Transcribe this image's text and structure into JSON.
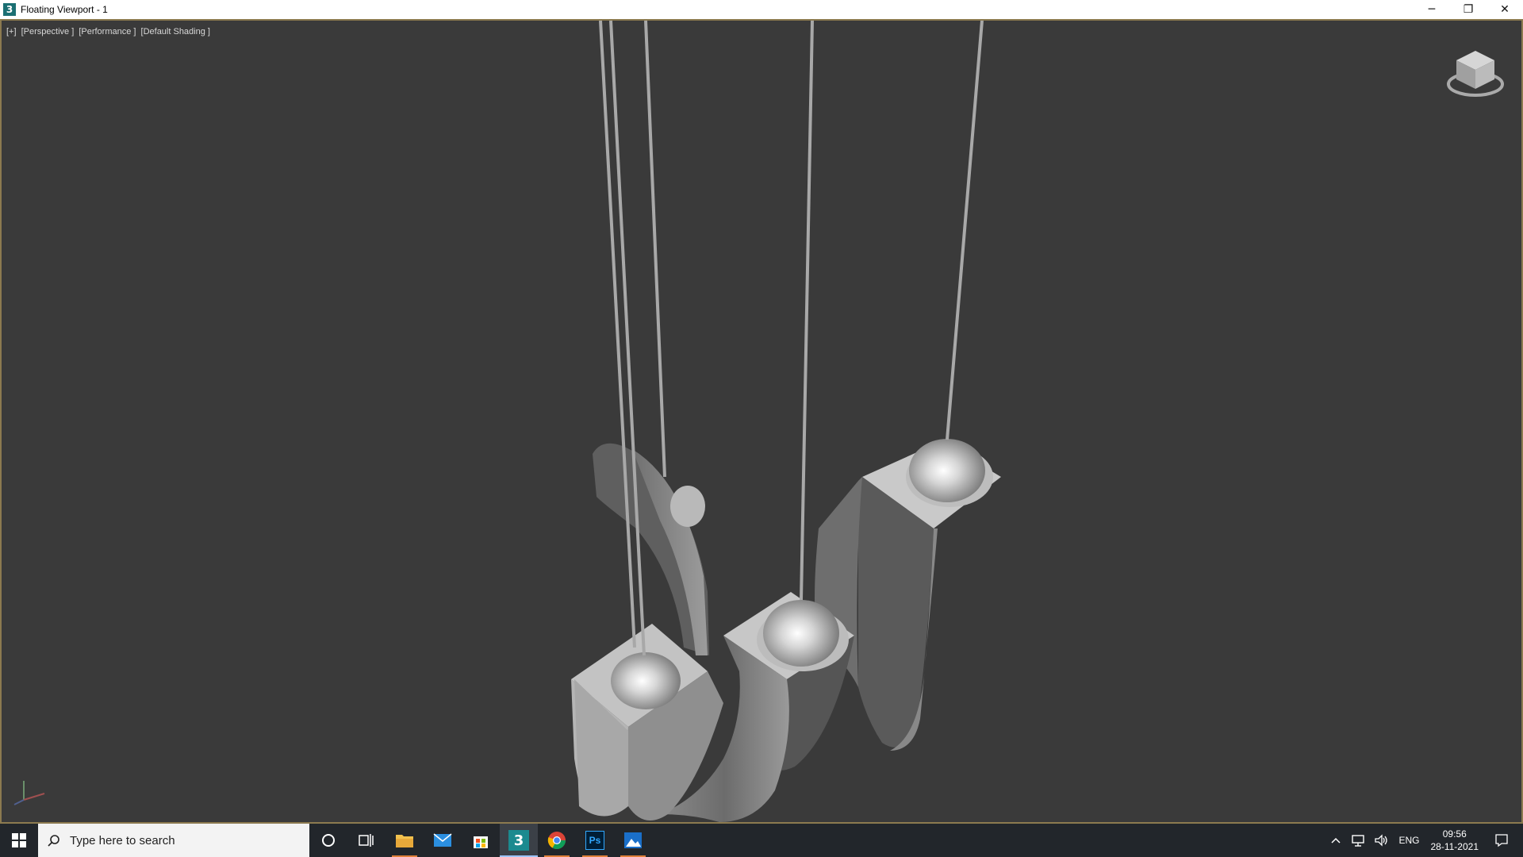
{
  "window": {
    "app_icon_glyph": "3",
    "title": "Floating Viewport - 1",
    "minimize_glyph": "─",
    "restore_glyph": "❐",
    "close_glyph": "✕"
  },
  "viewport": {
    "labels": [
      "[+]",
      "[Perspective ]",
      "[Performance ]",
      "[Default Shading ]"
    ],
    "background": "#3a3a3a",
    "border_color": "#8c7a4f"
  },
  "taskbar": {
    "search_placeholder": "Type here to search",
    "apps": [
      {
        "name": "cortana",
        "icon": "circle-icon"
      },
      {
        "name": "task-view",
        "icon": "task-view-icon"
      },
      {
        "name": "file-explorer",
        "icon": "folder-icon"
      },
      {
        "name": "mail",
        "icon": "mail-icon"
      },
      {
        "name": "store",
        "icon": "store-icon"
      },
      {
        "name": "3ds-max",
        "icon": "3dsmax-icon",
        "label": "3"
      },
      {
        "name": "chrome",
        "icon": "chrome-icon"
      },
      {
        "name": "photoshop",
        "icon": "photoshop-icon",
        "label": "Ps"
      },
      {
        "name": "photos",
        "icon": "photos-icon"
      }
    ],
    "tray": {
      "language": "ENG",
      "time": "09:56",
      "date": "28-11-2021"
    }
  }
}
